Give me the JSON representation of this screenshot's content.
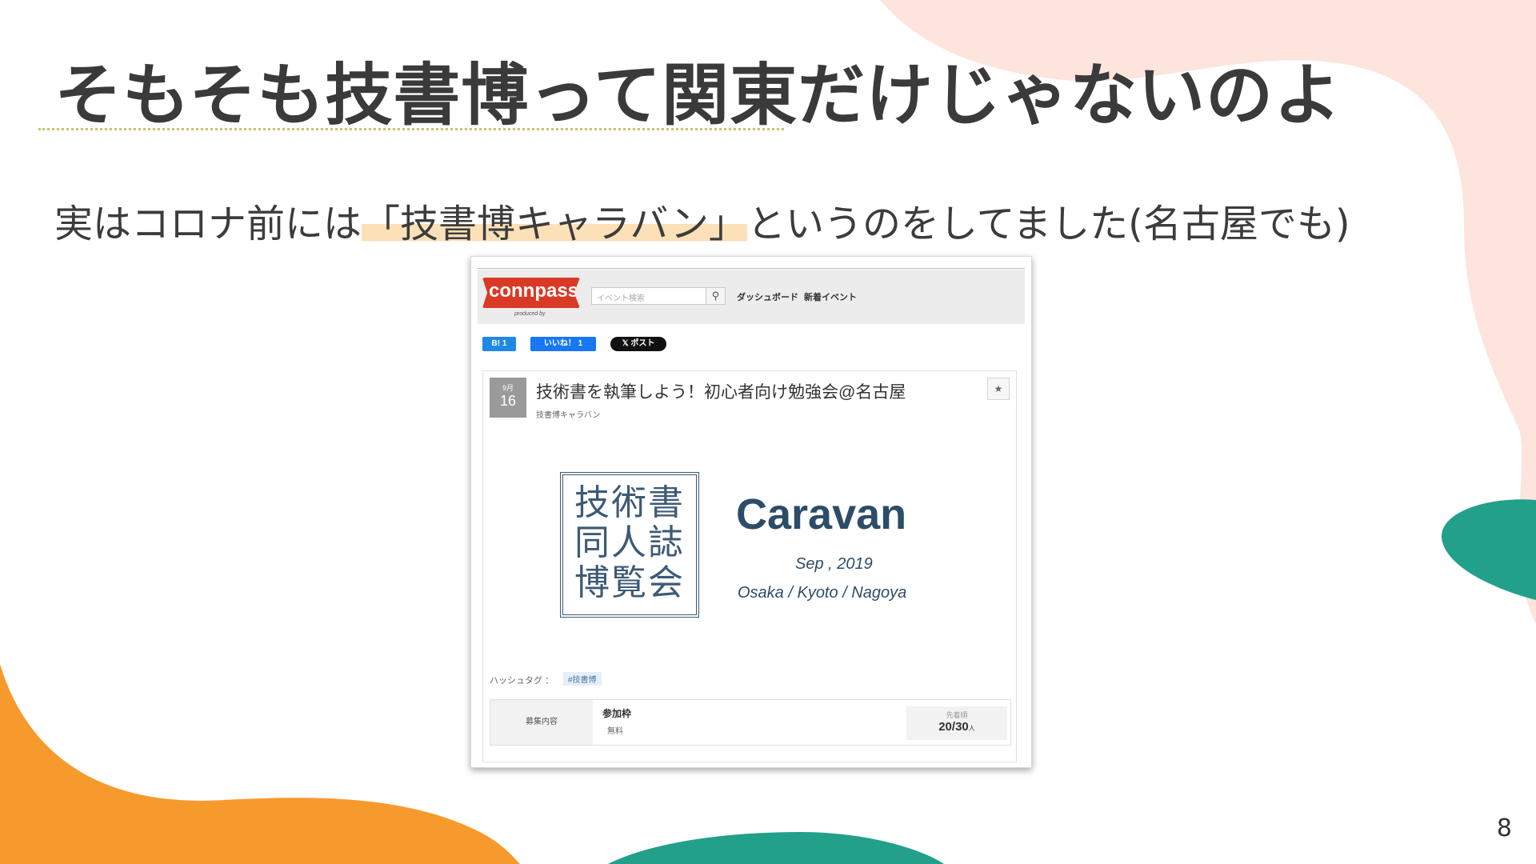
{
  "slide": {
    "title": "そもそも技書博って関東だけじゃないのよ",
    "subtitle_pre": "実はコロナ前には",
    "subtitle_highlight": "「技書博キャラバン」",
    "subtitle_post": "というのをしてました(名古屋でも)",
    "page_number": "8",
    "colors": {
      "orange": "#f79a2e",
      "teal": "#22a08a",
      "peach": "#fde4dc",
      "highlight": "#fbe0b8"
    }
  },
  "screenshot": {
    "header": {
      "logo": "connpass",
      "logo_sub": "produced by",
      "search_placeholder": "イベント検索",
      "search_icon": "magnifier-icon",
      "nav_dashboard": "ダッシュボード",
      "nav_new_event": "新着イベント"
    },
    "social": {
      "hatena": "B! 1",
      "facebook": "いいね！ 1",
      "x_post": "𝕏 ポスト"
    },
    "event": {
      "month": "9月",
      "day": "16",
      "title": "技術書を執筆しよう！初心者向け勉強会@名古屋",
      "group": "技書博キャラバン",
      "star": "★"
    },
    "banner": {
      "kanji_rows": [
        "技術書",
        "同人誌",
        "博覧会"
      ],
      "caravan": "Caravan",
      "date": "Sep , 2019",
      "cities": "Osaka / Kyoto / Nagoya"
    },
    "hashtag": {
      "label": "ハッシュタグ ：",
      "tag": "#技書博"
    },
    "recruit": {
      "label": "募集内容",
      "name": "参加枠",
      "price": "無料",
      "order": "先着順",
      "count": "20/30",
      "unit": "人"
    }
  }
}
